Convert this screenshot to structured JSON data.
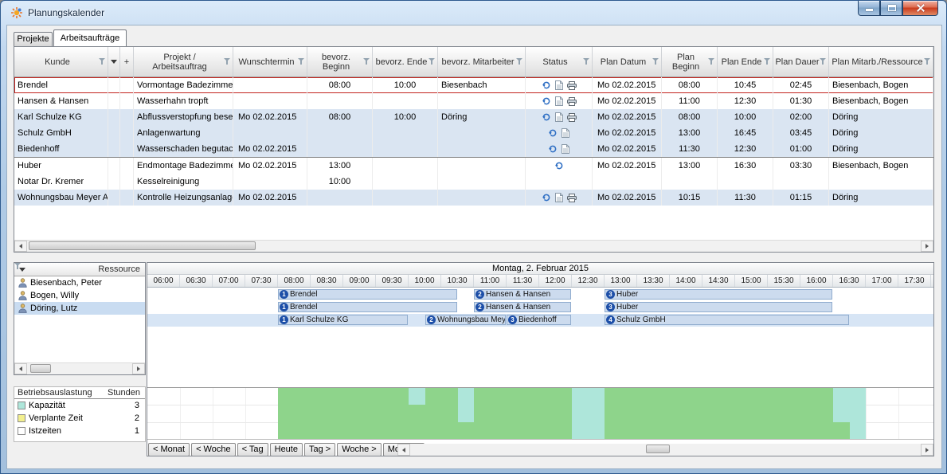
{
  "window": {
    "title": "Planungskalender"
  },
  "tabs": [
    {
      "label": "Projekte",
      "active": false
    },
    {
      "label": "Arbeitsaufträge",
      "active": true
    }
  ],
  "orders_table": {
    "columns": [
      {
        "label": "Kunde",
        "filter": true
      },
      {
        "label": "",
        "filter": false,
        "sort_indicator": true
      },
      {
        "label": "+",
        "filter": false
      },
      {
        "label": "Projekt / Arbeitsauftrag",
        "filter": true
      },
      {
        "label": "Wunschtermin",
        "filter": true
      },
      {
        "label": "bevorz. Beginn",
        "filter": true
      },
      {
        "label": "bevorz. Ende",
        "filter": true
      },
      {
        "label": "bevorz. Mitarbeiter",
        "filter": true
      },
      {
        "label": "Status",
        "filter": true
      },
      {
        "label": "Plan Datum",
        "filter": true
      },
      {
        "label": "Plan Beginn",
        "filter": true
      },
      {
        "label": "Plan Ende",
        "filter": true
      },
      {
        "label": "Plan Dauer",
        "filter": true
      },
      {
        "label": "Plan Mitarb./Ressource",
        "filter": true
      }
    ],
    "rows": [
      {
        "kunde": "Brendel",
        "projekt": "Vormontage Badezimmer",
        "wunschtermin": "",
        "bevorz_beginn": "08:00",
        "bevorz_ende": "10:00",
        "bevorz_mitarbeiter": "Biesenbach",
        "status_icons": [
          "refresh-icon",
          "document-icon",
          "print-icon"
        ],
        "plan_datum": "Mo 02.02.2015",
        "plan_beginn": "08:00",
        "plan_ende": "10:45",
        "plan_dauer": "02:45",
        "plan_ressource": "Biesenbach, Bogen",
        "selected": true,
        "shaded": false
      },
      {
        "kunde": "Hansen & Hansen",
        "projekt": "Wasserhahn tropft",
        "wunschtermin": "",
        "bevorz_beginn": "",
        "bevorz_ende": "",
        "bevorz_mitarbeiter": "",
        "status_icons": [
          "refresh-icon",
          "document-icon",
          "print-icon"
        ],
        "plan_datum": "Mo 02.02.2015",
        "plan_beginn": "11:00",
        "plan_ende": "12:30",
        "plan_dauer": "01:30",
        "plan_ressource": "Biesenbach, Bogen",
        "selected": false,
        "shaded": false
      },
      {
        "kunde": "Karl Schulze KG",
        "projekt": "Abflussverstopfung beseiti",
        "wunschtermin": "Mo 02.02.2015",
        "bevorz_beginn": "08:00",
        "bevorz_ende": "10:00",
        "bevorz_mitarbeiter": "Döring",
        "status_icons": [
          "refresh-icon",
          "document-icon",
          "print-icon"
        ],
        "plan_datum": "Mo 02.02.2015",
        "plan_beginn": "08:00",
        "plan_ende": "10:00",
        "plan_dauer": "02:00",
        "plan_ressource": "Döring",
        "selected": false,
        "shaded": true
      },
      {
        "kunde": "Schulz GmbH",
        "projekt": "Anlagenwartung",
        "wunschtermin": "",
        "bevorz_beginn": "",
        "bevorz_ende": "",
        "bevorz_mitarbeiter": "",
        "status_icons": [
          "refresh-icon",
          "document-icon"
        ],
        "plan_datum": "Mo 02.02.2015",
        "plan_beginn": "13:00",
        "plan_ende": "16:45",
        "plan_dauer": "03:45",
        "plan_ressource": "Döring",
        "selected": false,
        "shaded": true
      },
      {
        "kunde": "Biedenhoff",
        "projekt": "Wasserschaden begutach",
        "wunschtermin": "Mo 02.02.2015",
        "bevorz_beginn": "",
        "bevorz_ende": "",
        "bevorz_mitarbeiter": "",
        "status_icons": [
          "refresh-icon",
          "document-icon"
        ],
        "plan_datum": "Mo 02.02.2015",
        "plan_beginn": "11:30",
        "plan_ende": "12:30",
        "plan_dauer": "01:00",
        "plan_ressource": "Döring",
        "selected": false,
        "shaded": true
      },
      {
        "kunde": "Huber",
        "projekt": "Endmontage Badezimmer",
        "wunschtermin": "Mo 02.02.2015",
        "bevorz_beginn": "13:00",
        "bevorz_ende": "",
        "bevorz_mitarbeiter": "",
        "status_icons": [
          "refresh-icon"
        ],
        "plan_datum": "Mo 02.02.2015",
        "plan_beginn": "13:00",
        "plan_ende": "16:30",
        "plan_dauer": "03:30",
        "plan_ressource": "Biesenbach, Bogen",
        "selected": false,
        "shaded": false,
        "separator_above": true
      },
      {
        "kunde": "Notar Dr. Kremer",
        "projekt": "Kesselreinigung",
        "wunschtermin": "",
        "bevorz_beginn": "10:00",
        "bevorz_ende": "",
        "bevorz_mitarbeiter": "",
        "status_icons": [],
        "plan_datum": "",
        "plan_beginn": "",
        "plan_ende": "",
        "plan_dauer": "",
        "plan_ressource": "",
        "selected": false,
        "shaded": false
      },
      {
        "kunde": "Wohnungsbau Meyer AG",
        "projekt": "Kontrolle Heizungsanlage",
        "wunschtermin": "Mo 02.02.2015",
        "bevorz_beginn": "",
        "bevorz_ende": "",
        "bevorz_mitarbeiter": "",
        "status_icons": [
          "refresh-icon",
          "document-icon",
          "print-icon"
        ],
        "plan_datum": "Mo 02.02.2015",
        "plan_beginn": "10:15",
        "plan_ende": "11:30",
        "plan_dauer": "01:15",
        "plan_ressource": "Döring",
        "selected": false,
        "shaded": true
      }
    ]
  },
  "resources": {
    "header": "Ressource",
    "items": [
      {
        "name": "Biesenbach, Peter",
        "selected": false
      },
      {
        "name": "Bogen, Willy",
        "selected": false
      },
      {
        "name": "Döring, Lutz",
        "selected": true
      }
    ]
  },
  "timeline": {
    "date_label": "Montag, 2. Februar 2015",
    "ticks": [
      "06:00",
      "06:30",
      "07:00",
      "07:30",
      "08:00",
      "08:30",
      "09:00",
      "09:30",
      "10:00",
      "10:30",
      "11:00",
      "11:30",
      "12:00",
      "12:30",
      "13:00",
      "13:30",
      "14:00",
      "14:30",
      "15:00",
      "15:30",
      "16:00",
      "16:30",
      "17:00",
      "17:30"
    ],
    "rows": [
      {
        "resource": "Biesenbach, Peter",
        "selected": false,
        "bars": [
          {
            "n": 1,
            "label": "Brendel",
            "start": "08:00",
            "end": "10:45"
          },
          {
            "n": 2,
            "label": "Hansen & Hansen",
            "start": "11:00",
            "end": "12:30"
          },
          {
            "n": 3,
            "label": "Huber",
            "start": "13:00",
            "end": "16:30"
          }
        ]
      },
      {
        "resource": "Bogen, Willy",
        "selected": false,
        "bars": [
          {
            "n": 1,
            "label": "Brendel",
            "start": "08:00",
            "end": "10:45"
          },
          {
            "n": 2,
            "label": "Hansen & Hansen",
            "start": "11:00",
            "end": "12:30"
          },
          {
            "n": 3,
            "label": "Huber",
            "start": "13:00",
            "end": "16:30"
          }
        ]
      },
      {
        "resource": "Döring, Lutz",
        "selected": true,
        "bars": [
          {
            "n": 1,
            "label": "Karl Schulze KG",
            "start": "08:00",
            "end": "10:00"
          },
          {
            "n": 2,
            "label": "Wohnungsbau Meyer AG",
            "start": "10:15",
            "end": "11:30"
          },
          {
            "n": 3,
            "label": "Biedenhoff",
            "start": "11:30",
            "end": "12:30"
          },
          {
            "n": 4,
            "label": "Schulz GmbH",
            "start": "13:00",
            "end": "16:45"
          }
        ]
      }
    ]
  },
  "nav": {
    "buttons": [
      {
        "id": "nav-month-back",
        "label": "< Monat"
      },
      {
        "id": "nav-week-back",
        "label": "< Woche"
      },
      {
        "id": "nav-day-back",
        "label": "< Tag"
      },
      {
        "id": "nav-today",
        "label": "Heute"
      },
      {
        "id": "nav-day-forward",
        "label": "Tag >"
      },
      {
        "id": "nav-week-forward",
        "label": "Woche >"
      },
      {
        "id": "nav-month-forward",
        "label": "Monat >"
      }
    ]
  },
  "chart_data": {
    "type": "area",
    "title": "Betriebsauslastung",
    "unit_header": "Stunden",
    "x_axis": {
      "start": "06:00",
      "end": "18:00",
      "tick_interval_minutes": 30
    },
    "ylim": [
      0,
      3
    ],
    "legend": [
      {
        "label": "Kapazität",
        "value": 3,
        "color": "#aee6da"
      },
      {
        "label": "Verplante Zeit",
        "value": 2,
        "color": "#f2ef8e"
      },
      {
        "label": "Istzeiten",
        "value": 1,
        "color": "#ffffff"
      }
    ],
    "series": [
      {
        "name": "Kapazität",
        "render_color": "#aee6da",
        "segments": [
          {
            "start": "08:00",
            "end": "17:00",
            "value": 3
          }
        ]
      },
      {
        "name": "Verplante Zeit",
        "render_color": "#8ed48b",
        "segments": [
          {
            "start": "08:00",
            "end": "10:00",
            "value": 3
          },
          {
            "start": "10:00",
            "end": "10:15",
            "value": 2
          },
          {
            "start": "10:15",
            "end": "10:45",
            "value": 3
          },
          {
            "start": "10:45",
            "end": "11:00",
            "value": 1
          },
          {
            "start": "11:00",
            "end": "12:30",
            "value": 3
          },
          {
            "start": "13:00",
            "end": "16:30",
            "value": 3
          },
          {
            "start": "16:30",
            "end": "16:45",
            "value": 1
          }
        ]
      }
    ]
  }
}
